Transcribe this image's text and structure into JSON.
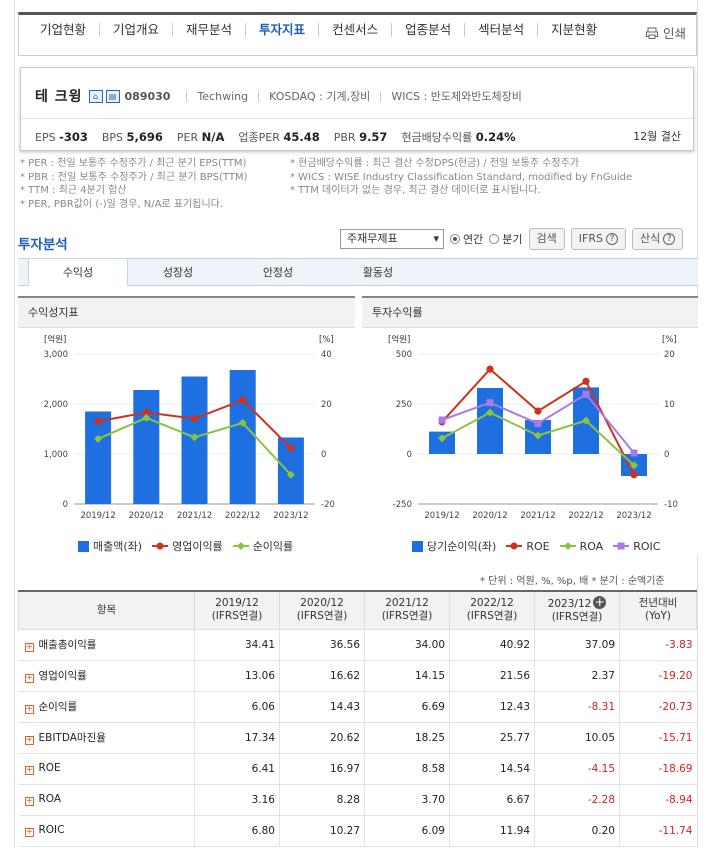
{
  "topnav": {
    "items": [
      "기업현황",
      "기업개요",
      "재무분석",
      "투자지표",
      "컨센서스",
      "업종분석",
      "섹터분석",
      "지분현황"
    ],
    "active_index": 3,
    "print_label": "인쇄"
  },
  "company": {
    "name": "테 크윙",
    "code": "089030",
    "eng_name": "Techwing",
    "market": "KOSDAQ : 기계,장비",
    "wics": "WICS : 반도체와반도체장비",
    "stats": [
      {
        "label": "EPS",
        "value": "-303"
      },
      {
        "label": "BPS",
        "value": "5,696"
      },
      {
        "label": "PER",
        "value": "N/A"
      },
      {
        "label": "업종PER",
        "value": "45.48"
      },
      {
        "label": "PBR",
        "value": "9.57"
      },
      {
        "label": "현금배당수익률",
        "value": "0.24%"
      }
    ],
    "settlement": "12월 결산"
  },
  "notes": {
    "left": [
      "* PER : 전일 보통주 수정주가 / 최근 분기 EPS(TTM)",
      "* PBR : 전일 보통주 수정주가 / 최근 분기 BPS(TTM)",
      "* TTM : 최근 4분기 합산",
      "* PER, PBR값이 (-)일 경우, N/A로 표기됩니다."
    ],
    "right": [
      "* 현금배당수익률 : 최근 결산 수정DPS(현금) / 전일 보통주 수정주가",
      "* WICS : WISE Industry Classification Standard, modified by FnGuide",
      "* TTM 데이터가 없는 경우, 최근 결산 데이터로 표시됩니다."
    ]
  },
  "analysis": {
    "title": "투자분석",
    "select_value": "주재무제표",
    "radio_annual": "연간",
    "radio_quarter": "분기",
    "search_button": "검색",
    "ifrs_button": "IFRS",
    "formula_button": "산식",
    "tabs": [
      "수익성",
      "성장성",
      "안정성",
      "활동성"
    ],
    "active_tab": 0
  },
  "colors": {
    "bar": "#1e6fe0",
    "red": "#d0311e",
    "green": "#8bc53f",
    "purple": "#a87be6",
    "accent": "#1f5fb8",
    "negative": "#d71f1f"
  },
  "chart_data": [
    {
      "type": "bar",
      "title": "수익성지표",
      "categories": [
        "2019/12",
        "2020/12",
        "2021/12",
        "2022/12",
        "2023/12"
      ],
      "y_left_label": "[억원]",
      "y_right_label": "[%]",
      "ylim_left": [
        0,
        3000
      ],
      "ylim_right": [
        -20,
        40
      ],
      "y_left_ticks": [
        "3,000",
        "2,000",
        "1,000",
        "0"
      ],
      "y_right_ticks": [
        "40",
        "20",
        "0",
        "-20"
      ],
      "series": [
        {
          "name": "매출액(좌)",
          "axis": "left",
          "kind": "bar",
          "values": [
            1850,
            2280,
            2550,
            2680,
            1330
          ]
        },
        {
          "name": "영업이익률",
          "axis": "right",
          "kind": "line",
          "values": [
            13.06,
            16.62,
            14.15,
            21.56,
            2.37
          ]
        },
        {
          "name": "순이익률",
          "axis": "right",
          "kind": "line",
          "values": [
            6.06,
            14.43,
            6.69,
            12.43,
            -8.31
          ]
        }
      ]
    },
    {
      "type": "bar",
      "title": "투자수익률",
      "categories": [
        "2019/12",
        "2020/12",
        "2021/12",
        "2022/12",
        "2023/12"
      ],
      "y_left_label": "[억원]",
      "y_right_label": "[%]",
      "ylim_left": [
        -250,
        500
      ],
      "ylim_right": [
        -10,
        20
      ],
      "y_left_ticks": [
        "500",
        "250",
        "0",
        "-250"
      ],
      "y_right_ticks": [
        "20",
        "10",
        "0",
        "-10"
      ],
      "series": [
        {
          "name": "당기순이익(좌)",
          "axis": "left",
          "kind": "bar",
          "values": [
            112,
            330,
            170,
            333,
            -110
          ]
        },
        {
          "name": "ROE",
          "axis": "right",
          "kind": "line",
          "values": [
            6.41,
            16.97,
            8.58,
            14.54,
            -4.15
          ]
        },
        {
          "name": "ROA",
          "axis": "right",
          "kind": "line",
          "values": [
            3.16,
            8.28,
            3.7,
            6.67,
            -2.28
          ]
        },
        {
          "name": "ROIC",
          "axis": "right",
          "kind": "line",
          "values": [
            6.8,
            10.27,
            6.09,
            11.94,
            0.2
          ]
        }
      ]
    }
  ],
  "unit_note": "* 단위 : 억원, %, %p, 배     * 분기 : 순액기준",
  "table": {
    "header_item": "항목",
    "columns": [
      {
        "period": "2019/12",
        "basis": "(IFRS연결)"
      },
      {
        "period": "2020/12",
        "basis": "(IFRS연결)"
      },
      {
        "period": "2021/12",
        "basis": "(IFRS연결)"
      },
      {
        "period": "2022/12",
        "basis": "(IFRS연결)"
      },
      {
        "period": "2023/12",
        "basis": "(IFRS연결)"
      }
    ],
    "yoy_header": "전년대비",
    "yoy_sub": "(YoY)",
    "rows": [
      {
        "label": "매출총이익률",
        "values": [
          "34.41",
          "36.56",
          "34.00",
          "40.92",
          "37.09"
        ],
        "yoy": "-3.83"
      },
      {
        "label": "영업이익률",
        "values": [
          "13.06",
          "16.62",
          "14.15",
          "21.56",
          "2.37"
        ],
        "yoy": "-19.20"
      },
      {
        "label": "순이익률",
        "values": [
          "6.06",
          "14.43",
          "6.69",
          "12.43",
          "-8.31"
        ],
        "yoy": "-20.73"
      },
      {
        "label": "EBITDA마진율",
        "values": [
          "17.34",
          "20.62",
          "18.25",
          "25.77",
          "10.05"
        ],
        "yoy": "-15.71"
      },
      {
        "label": "ROE",
        "values": [
          "6.41",
          "16.97",
          "8.58",
          "14.54",
          "-4.15"
        ],
        "yoy": "-18.69"
      },
      {
        "label": "ROA",
        "values": [
          "3.16",
          "8.28",
          "3.70",
          "6.67",
          "-2.28"
        ],
        "yoy": "-8.94"
      },
      {
        "label": "ROIC",
        "values": [
          "6.80",
          "10.27",
          "6.09",
          "11.94",
          "0.20"
        ],
        "yoy": "-11.74"
      }
    ]
  }
}
